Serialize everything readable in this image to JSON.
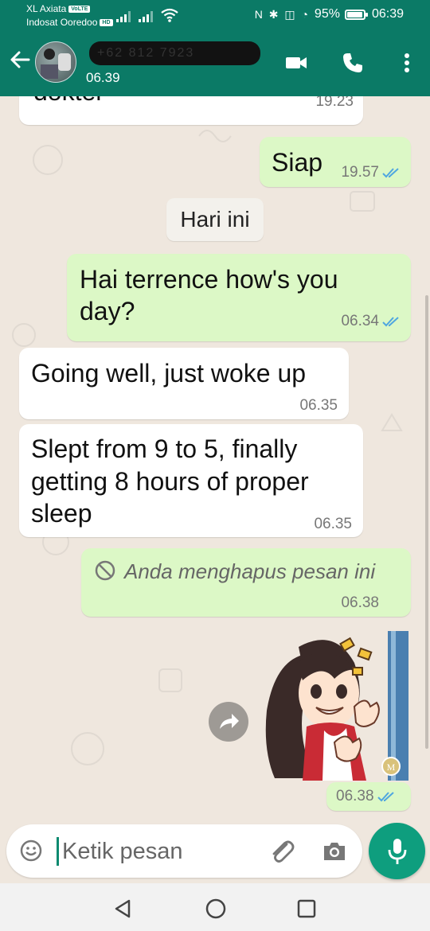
{
  "status_bar": {
    "carrier1": "XL Axiata",
    "carrier1_tag": "VoLTE",
    "carrier2": "Indosat Ooredoo",
    "carrier2_tag": "HD",
    "icons": "N ✱ ◫ ◔",
    "battery_percent": "95%",
    "battery_level": 0.95,
    "time": "06:39"
  },
  "header": {
    "contact_name_redacted": "+62 812 7923",
    "last_seen": "06.39",
    "icons": [
      "back-arrow-icon",
      "video-call-icon",
      "phone-call-icon",
      "more-menu-icon"
    ]
  },
  "messages": {
    "m0": {
      "text": "dokter",
      "time": "19.23",
      "direction": "incoming"
    },
    "m1": {
      "text": "Siap",
      "time": "19.57",
      "direction": "outgoing",
      "read": true
    },
    "date_chip": "Hari ini",
    "m2": {
      "line1": "Hai terrence how's you",
      "line2": "day?",
      "time": "06.34",
      "direction": "outgoing",
      "read": true
    },
    "m3": {
      "text": "Going well, just woke up",
      "time": "06.35",
      "direction": "incoming"
    },
    "m4": {
      "line1": "Slept from 9 to 5, finally",
      "line2": "getting 8 hours of proper",
      "line3": "sleep",
      "time": "06.35",
      "direction": "incoming"
    },
    "m5": {
      "text": "Anda menghapus pesan ini",
      "time": "06.38",
      "direction": "outgoing",
      "deleted": true
    },
    "m6": {
      "type": "sticker",
      "time": "06.38",
      "direction": "outgoing",
      "read": true
    }
  },
  "composer": {
    "placeholder": "Ketik pesan",
    "icons": [
      "emoji-icon",
      "attach-icon",
      "camera-icon",
      "mic-icon"
    ]
  },
  "colors": {
    "header": "#0b7a66",
    "outgoing_bubble": "#dcf8c6",
    "incoming_bubble": "#ffffff",
    "chat_bg": "#efe7de",
    "read_ticks": "#4fa6e0",
    "mic_button": "#0e9e7e"
  }
}
